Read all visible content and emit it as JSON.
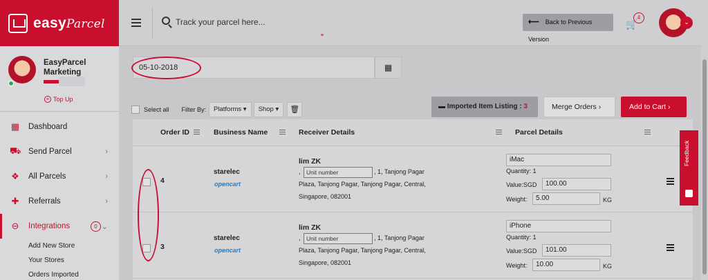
{
  "app": {
    "brand_main": "easy",
    "brand_script": "Parcel",
    "accent_color": "#c8102e"
  },
  "profile": {
    "name": "EasyParcel Marketing",
    "topup_label": "Top Up"
  },
  "sidebar": {
    "items": [
      {
        "label": "Dashboard",
        "icon": "dashboard-icon"
      },
      {
        "label": "Send Parcel",
        "icon": "truck-icon"
      },
      {
        "label": "All Parcels",
        "icon": "parcels-icon"
      },
      {
        "label": "Referrals",
        "icon": "referral-icon"
      },
      {
        "label": "Integrations",
        "icon": "link-icon",
        "badge": "0"
      }
    ],
    "sub_items": [
      "Add New Store",
      "Your Stores",
      "Orders Imported"
    ]
  },
  "topbar": {
    "search_placeholder": "Track your parcel here...",
    "back_label": "Back to Previous Version",
    "cart_count": "4"
  },
  "filter": {
    "date_value": "05-10-2018",
    "select_all_label": "Select all",
    "filter_by_label": "Filter By:",
    "platforms_label": "Platforms",
    "shop_label": "Shop"
  },
  "actions": {
    "imported_label": "Imported Item Listing :",
    "imported_count": "3",
    "merge_label": "Merge Orders",
    "add_cart_label": "Add to Cart"
  },
  "table": {
    "headers": [
      "Order ID",
      "Business Name",
      "Receiver Details",
      "Parcel Details"
    ],
    "rows": [
      {
        "order_id": "4",
        "business": "starelec",
        "platform": "opencart",
        "receiver_name": "lim ZK",
        "unit_placeholder": "Unit number",
        "addr_1": "1, Tanjong Pagar",
        "addr_2": "Plaza, Tanjong Pagar, Tanjong Pagar, Central,",
        "addr_3": "Singapore, 082001",
        "item": "iMac",
        "quantity_label": "Quantity: 1",
        "value_label": "Value:SGD",
        "value": "100.00",
        "weight_label": "Weight:",
        "weight": "5.00",
        "unit": "KG"
      },
      {
        "order_id": "3",
        "business": "starelec",
        "platform": "opencart",
        "receiver_name": "lim ZK",
        "unit_placeholder": "Unit number",
        "addr_1": "1, Tanjong Pagar",
        "addr_2": "Plaza, Tanjong Pagar, Tanjong Pagar, Central,",
        "addr_3": "Singapore, 082001",
        "item": "iPhone",
        "quantity_label": "Quantity: 1",
        "value_label": "Value:SGD",
        "value": "101.00",
        "weight_label": "Weight:",
        "weight": "10.00",
        "unit": "KG"
      }
    ]
  },
  "feedback_label": "Feedback"
}
